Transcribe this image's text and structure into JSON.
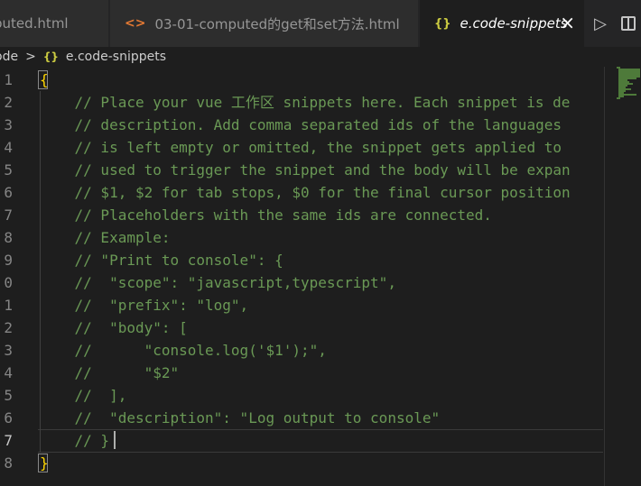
{
  "tabs": [
    {
      "label": "puted.html",
      "icon": "html-file-icon",
      "active": false
    },
    {
      "label": "03-01-computed的get和set方法.html",
      "icon": "html-file-icon",
      "active": false
    },
    {
      "label": "e.code-snippets",
      "icon": "json-braces-icon",
      "active": true
    }
  ],
  "tab_icons": {
    "html": "<>",
    "json": "{}"
  },
  "actions": {
    "run": "▷",
    "close": "×"
  },
  "breadcrumb": {
    "folder": "ode",
    "separator": ">",
    "file": "e.code-snippets"
  },
  "editor": {
    "active_line": 17,
    "line_numbers": [
      "1",
      "2",
      "3",
      "4",
      "5",
      "6",
      "7",
      "8",
      "9",
      "0",
      "1",
      "2",
      "3",
      "4",
      "5",
      "6",
      "7",
      "8"
    ],
    "lines": [
      "{",
      "    // Place your vue 工作区 snippets here. Each snippet is de",
      "    // description. Add comma separated ids of the languages",
      "    // is left empty or omitted, the snippet gets applied to",
      "    // used to trigger the snippet and the body will be expan",
      "    // $1, $2 for tab stops, $0 for the final cursor position",
      "    // Placeholders with the same ids are connected.",
      "    // Example:",
      "    // \"Print to console\": {",
      "    //  \"scope\": \"javascript,typescript\",",
      "    //  \"prefix\": \"log\",",
      "    //  \"body\": [",
      "    //      \"console.log('$1');\",",
      "    //      \"$2\"",
      "    //  ],",
      "    //  \"description\": \"Log output to console\"",
      "    // }",
      "}"
    ]
  },
  "colors": {
    "background": "#1e1e1e",
    "comment": "#6a9955",
    "brace": "#ffd700",
    "line_number": "#858585"
  }
}
